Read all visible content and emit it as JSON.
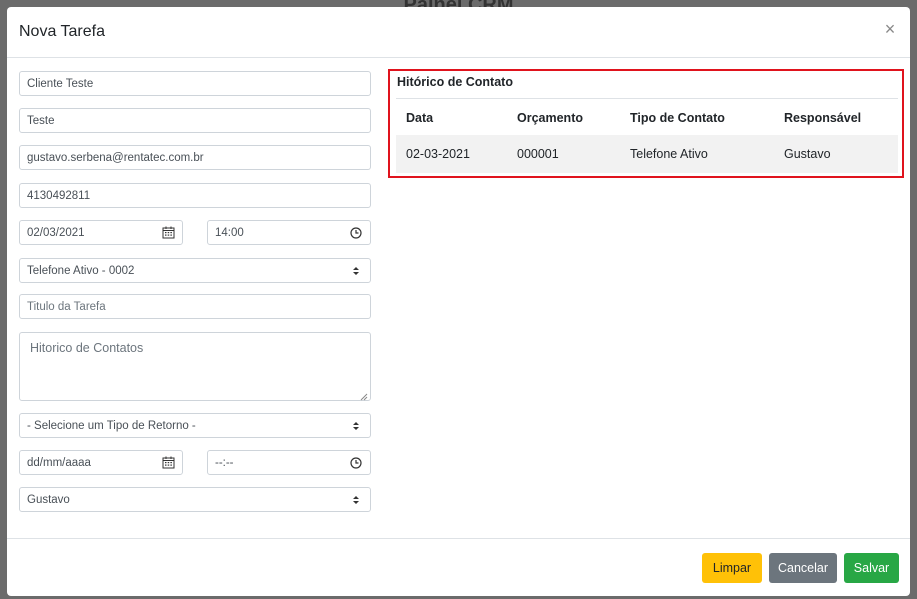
{
  "background": {
    "title": "Painel CRM"
  },
  "modal": {
    "title": "Nova Tarefa",
    "close_label": "×"
  },
  "form": {
    "cliente": "Cliente Teste",
    "contato": "Teste",
    "email": "gustavo.serbena@rentatec.com.br",
    "telefone": "4130492811",
    "data": "02/03/2021",
    "hora": "14:00",
    "tipo_contato": "Telefone Ativo - 0002",
    "titulo_placeholder": "Titulo da Tarefa",
    "historico_placeholder": "Hitorico de Contatos",
    "tipo_retorno": "- Selecione um Tipo de Retorno -",
    "data_retorno_placeholder": "dd/mm/aaaa",
    "hora_retorno_placeholder": "--:--",
    "responsavel": "Gustavo"
  },
  "history": {
    "title": "Hitórico de Contato",
    "columns": [
      "Data",
      "Orçamento",
      "Tipo de Contato",
      "Responsável"
    ],
    "rows": [
      [
        "02-03-2021",
        "000001",
        "Telefone Ativo",
        "Gustavo"
      ]
    ],
    "highlight_color": "#e0131d"
  },
  "footer": {
    "limpar": "Limpar",
    "cancelar": "Cancelar",
    "salvar": "Salvar"
  },
  "colors": {
    "warning": "#ffc107",
    "secondary": "#6c757d",
    "success": "#28a745"
  }
}
